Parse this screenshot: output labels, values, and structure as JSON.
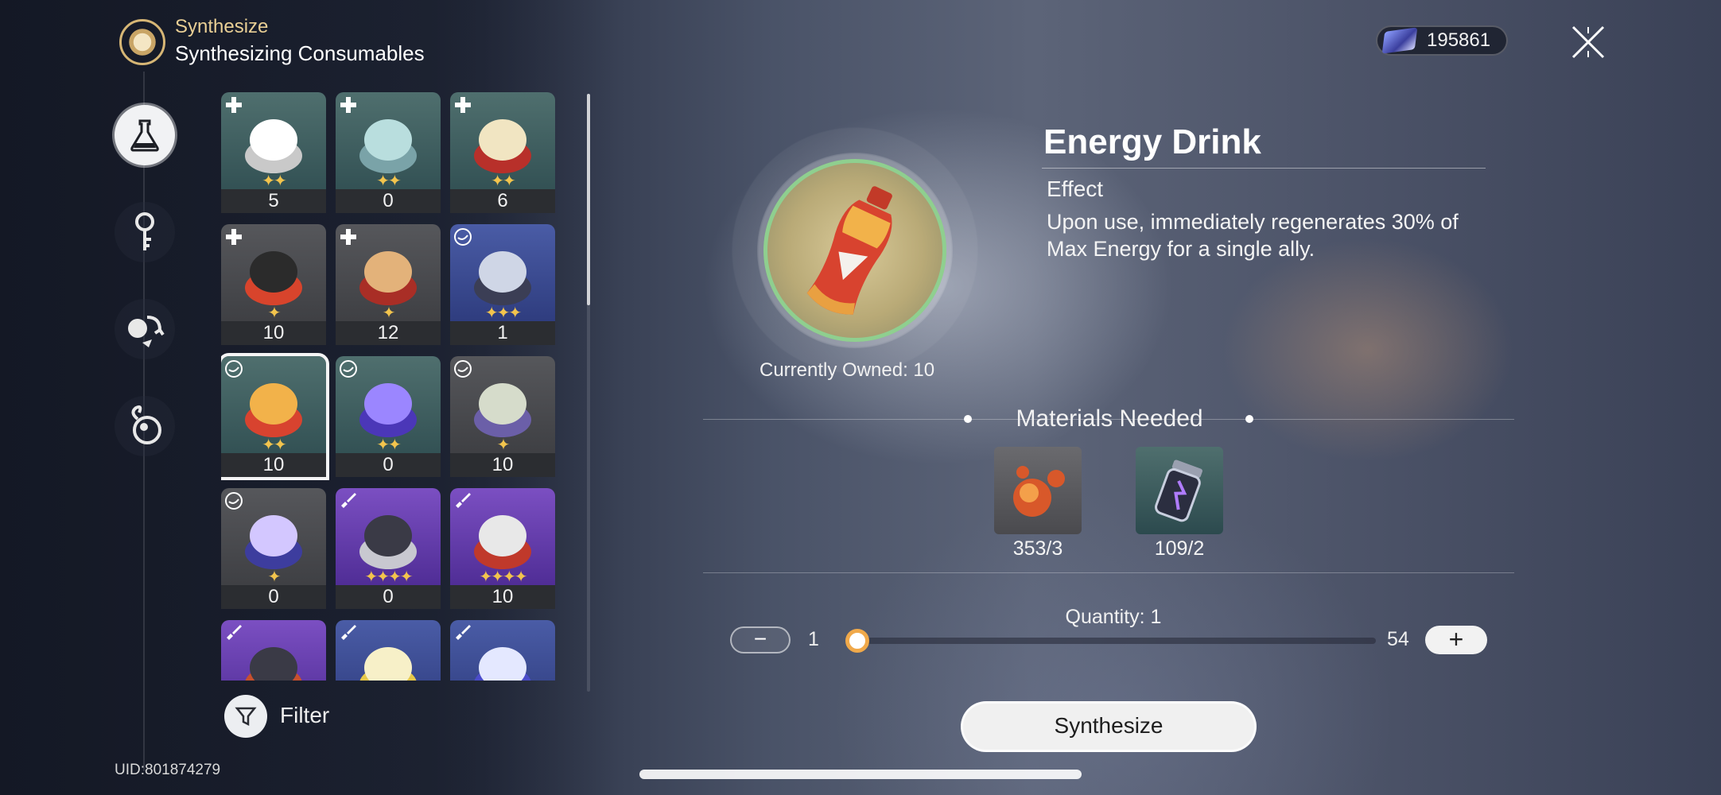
{
  "header": {
    "section": "Synthesize",
    "title": "Synthesizing Consumables",
    "currency_value": "195861"
  },
  "nav": [
    {
      "name": "synthesize-consumables-tab",
      "icon": "flask-icon",
      "active": true
    },
    {
      "name": "material-tab",
      "icon": "key-icon",
      "active": false
    },
    {
      "name": "exchange-tab",
      "icon": "swap-icon",
      "active": false
    },
    {
      "name": "special-tab",
      "icon": "bomb-icon",
      "active": false
    }
  ],
  "items": [
    {
      "count": "5",
      "stars": 2,
      "rarity": "r2",
      "tag": "plus-tag-icon",
      "art": "rice-bowl-icon"
    },
    {
      "count": "0",
      "stars": 2,
      "rarity": "r2",
      "tag": "plus-tag-icon",
      "art": "oxygen-mask-icon"
    },
    {
      "count": "6",
      "stars": 2,
      "rarity": "r2",
      "tag": "plus-tag-icon",
      "art": "fried-rice-icon"
    },
    {
      "count": "10",
      "stars": 1,
      "rarity": "r1",
      "tag": "plus-tag-icon",
      "art": "defibrillator-icon"
    },
    {
      "count": "12",
      "stars": 1,
      "rarity": "r1",
      "tag": "plus-tag-icon",
      "art": "noodle-bowl-icon"
    },
    {
      "count": "1",
      "stars": 3,
      "rarity": "r3",
      "tag": "energy-tag-icon",
      "art": "bottle-icon"
    },
    {
      "count": "10",
      "stars": 2,
      "rarity": "r2",
      "tag": "energy-tag-icon",
      "art": "energy-drink-icon",
      "selected": true
    },
    {
      "count": "0",
      "stars": 2,
      "rarity": "r2",
      "tag": "energy-tag-icon",
      "art": "purple-bottle-icon"
    },
    {
      "count": "10",
      "stars": 1,
      "rarity": "r1",
      "tag": "energy-tag-icon",
      "art": "snack-bag-icon"
    },
    {
      "count": "0",
      "stars": 1,
      "rarity": "r1",
      "tag": "energy-tag-icon",
      "art": "purple-bowl-icon"
    },
    {
      "count": "0",
      "stars": 4,
      "rarity": "r4",
      "tag": "sword-tag-icon",
      "art": "scarf-icon"
    },
    {
      "count": "10",
      "stars": 4,
      "rarity": "r4",
      "tag": "sword-tag-icon",
      "art": "extinguisher-icon"
    },
    {
      "count": "",
      "stars": 0,
      "rarity": "r4",
      "tag": "sword-tag-icon",
      "art": "gadget-icon"
    },
    {
      "count": "",
      "stars": 0,
      "rarity": "r3",
      "tag": "sword-tag-icon",
      "art": "yellow-tube-icon"
    },
    {
      "count": "",
      "stars": 0,
      "rarity": "r3",
      "tag": "sword-tag-icon",
      "art": "blue-tube-icon"
    }
  ],
  "filter_label": "Filter",
  "uid": "UID:801874279",
  "detail": {
    "name": "Energy Drink",
    "effect_title": "Effect",
    "effect_text": "Upon use, immediately regenerates 30% of Max Energy for a single ally.",
    "owned": "Currently Owned: 10"
  },
  "materials": {
    "title": "Materials Needed",
    "items": [
      {
        "count": "353/3",
        "icon": "spark-orbs-icon"
      },
      {
        "count": "109/2",
        "icon": "energy-vial-icon"
      }
    ]
  },
  "quantity": {
    "label": "Quantity: 1",
    "min": "1",
    "max": "54",
    "value": 1,
    "range_min": 1,
    "range_max": 54
  },
  "synthesize_label": "Synthesize",
  "colors": {
    "accent_gold": "#e9cf95",
    "slider_orange": "#f0a94a",
    "star_gold": "#f2c44d"
  }
}
